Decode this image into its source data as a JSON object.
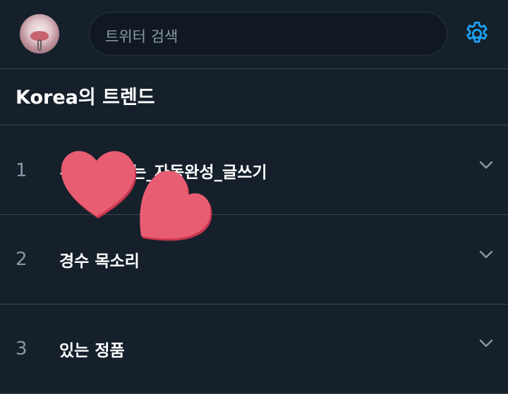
{
  "header": {
    "search_placeholder": "트위터 검색"
  },
  "section": {
    "title": "Korea의 트렌드"
  },
  "trends": [
    {
      "rank": "1",
      "name": "#          _시작하는_자동완성_글쓰기"
    },
    {
      "rank": "2",
      "name": "경수 목소리"
    },
    {
      "rank": "3",
      "name": "있는 정품"
    }
  ],
  "colors": {
    "background": "#15202b",
    "accent": "#1da1f2",
    "divider": "#38444d",
    "heart": "#e85d72"
  },
  "icons": {
    "settings": "gear-icon",
    "expand": "chevron-down-icon"
  }
}
